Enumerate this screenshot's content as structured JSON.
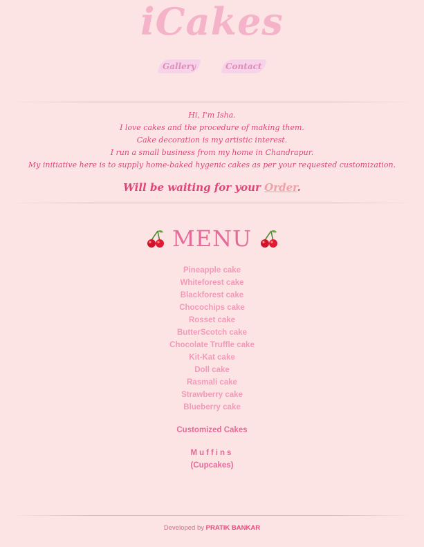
{
  "brand": {
    "title": "iCakes"
  },
  "nav": {
    "items": [
      {
        "label": "Gallery"
      },
      {
        "label": "Contact"
      }
    ]
  },
  "intro": {
    "lines": [
      "Hi, I'm Isha.",
      "I love cakes and the procedure of making them.",
      "Cake decoration is my artistic interest.",
      "I run a small business from my home in Chandrapur.",
      "My initiative here is to supply home-baked hygenic cakes as per your requested customization."
    ],
    "waiting_prefix": "Will be waiting for your ",
    "order_link": "Order",
    "waiting_suffix": "."
  },
  "menu": {
    "heading": "MENU",
    "icon": "cherry-icon",
    "items": [
      "Pineapple cake",
      "Whiteforest cake",
      "Blackforest cake",
      "Chocochips cake",
      "Rosset cake",
      "ButterScotch cake",
      "Chocolate Truffle cake",
      "Kit-Kat cake",
      "Doll cake",
      "Rasmali cake",
      "Strawberry cake",
      "Blueberry cake"
    ],
    "customized": "Customized Cakes",
    "muffins": "Muffins",
    "cupcakes": "(Cupcakes)"
  },
  "footer": {
    "prefix": "Developed by",
    "author": "PRATIK BANKAR"
  },
  "colors": {
    "background": "#fde4e4",
    "brand": "#f4b3c8",
    "accent": "#e0457a",
    "menu_item": "#f19ab9",
    "menu_title": "#e56a9a",
    "nav_bg": "#f6d3ea"
  }
}
